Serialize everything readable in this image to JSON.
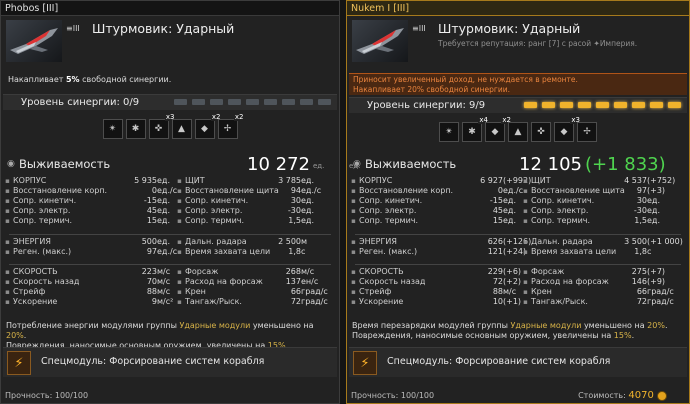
{
  "left": {
    "title": "Phobos [III]",
    "chevron": "≡III",
    "name": "Штурмовик: Ударный",
    "subtitle": "",
    "accum": [
      "Накапливает ",
      "5%",
      " свободной синергии."
    ],
    "syn_label": "Уровень синергии: 0/9",
    "syn_level": 0,
    "syn_max": 9,
    "mods": [
      {
        "g": "✴",
        "c": ""
      },
      {
        "g": "✱",
        "c": ""
      },
      {
        "g": "✜",
        "c": "x3"
      },
      {
        "g": "▲",
        "c": ""
      },
      {
        "g": "◆",
        "c": "x2"
      },
      {
        "g": "✢",
        "c": "x2"
      }
    ],
    "surv_label": "Выживаемость",
    "surv_value": "10 272",
    "surv_delta": "",
    "unit": "ед.",
    "rows1": [
      [
        "КОРПУС",
        "5 935",
        "ед.",
        "ЩИТ",
        "3 785",
        "ед."
      ],
      [
        "Восстановление корп.",
        "0",
        "ед./с",
        "Восстановление щита",
        "94",
        "ед./с"
      ],
      [
        "Сопр. кинетич.",
        "-15",
        "ед.",
        "Сопр. кинетич.",
        "30",
        "ед."
      ],
      [
        "Сопр. электр.",
        "45",
        "ед.",
        "Сопр. электр.",
        "-30",
        "ед."
      ],
      [
        "Сопр. термич.",
        "15",
        "ед.",
        "Сопр. термич.",
        "1,5",
        "ед."
      ]
    ],
    "rows2": [
      [
        "ЭНЕРГИЯ",
        "500",
        "ед.",
        "Дальн. радара",
        "2 500",
        "м"
      ],
      [
        "Реген. (макс.)",
        "97",
        "ед./с",
        "Время захвата цели",
        "1,8",
        "с"
      ]
    ],
    "rows3": [
      [
        "СКОРОСТЬ",
        "223",
        "м/с",
        "Форсаж",
        "268",
        "м/с"
      ],
      [
        "Скорость назад",
        "70",
        "м/с",
        "Расход на форсаж",
        "137",
        "ен/с"
      ],
      [
        "Стрейф",
        "88",
        "м/с",
        "Крен",
        "66",
        "град/с"
      ],
      [
        "Ускорение",
        "9",
        "м/с²",
        "Тангаж/Рыск.",
        "72",
        "град/с"
      ]
    ],
    "note": [
      "Потребление энергии модулями группы ",
      "Ударные модули",
      " уменьшено на ",
      "20%",
      ".",
      "Повреждения, наносимые основным оружием, увеличены на ",
      "15%",
      "."
    ],
    "spec": "Спецмодуль: Форсирование систем корабля",
    "durability": "Прочность: 100/100"
  },
  "right": {
    "title": "Nukem I [III]",
    "chevron": "≡III",
    "name": "Штурмовик: Ударный",
    "subtitle": "Требуется репутация: ранг [7] с расой ✦Империя.",
    "warn1": "Приносит увеличенный доход, не нуждается в ремонте.",
    "warn2": "Накапливает 20% свободной синергии.",
    "syn_label": "Уровень синергии: 9/9",
    "syn_level": 9,
    "syn_max": 9,
    "mods": [
      {
        "g": "✴",
        "c": ""
      },
      {
        "g": "✱",
        "c": "x4"
      },
      {
        "g": "◆",
        "c": "x2"
      },
      {
        "g": "▲",
        "c": ""
      },
      {
        "g": "✜",
        "c": ""
      },
      {
        "g": "◆",
        "c": "x3"
      },
      {
        "g": "✢",
        "c": ""
      }
    ],
    "surv_label": "Выживаемость",
    "surv_value": "12 105",
    "surv_delta": "(+1 833)",
    "unit": "ед.",
    "rows1": [
      [
        "КОРПУС",
        "6 927",
        "(+992)",
        "ЩИТ",
        "4 537",
        "(+752)"
      ],
      [
        "Восстановление корп.",
        "0",
        "ед./с",
        "Восстановление щита",
        "97",
        "(+3)"
      ],
      [
        "Сопр. кинетич.",
        "-15",
        "ед.",
        "Сопр. кинетич.",
        "30",
        "ед."
      ],
      [
        "Сопр. электр.",
        "45",
        "ед.",
        "Сопр. электр.",
        "-30",
        "ед."
      ],
      [
        "Сопр. термич.",
        "15",
        "ед.",
        "Сопр. термич.",
        "1,5",
        "ед."
      ]
    ],
    "rows2": [
      [
        "ЭНЕРГИЯ",
        "626",
        "(+126)",
        "Дальн. радара",
        "3 500",
        "(+1 000)"
      ],
      [
        "Реген. (макс.)",
        "121",
        "(+24)",
        "Время захвата цели",
        "1,8",
        "с"
      ]
    ],
    "rows3": [
      [
        "СКОРОСТЬ",
        "229",
        "(+6)",
        "Форсаж",
        "275",
        "(+7)"
      ],
      [
        "Скорость назад",
        "72",
        "(+2)",
        "Расход на форсаж",
        "146",
        "(+9)"
      ],
      [
        "Стрейф",
        "88",
        "м/с",
        "Крен",
        "66",
        "град/с"
      ],
      [
        "Ускорение",
        "10",
        "(+1)",
        "Тангаж/Рыск.",
        "72",
        "град/с"
      ]
    ],
    "note": [
      "Время перезарядки модулей группы ",
      "Ударные модули",
      " уменьшено на ",
      "20%",
      ".",
      "Повреждения, наносимые основным оружием, увеличены на ",
      "15%",
      "."
    ],
    "spec": "Спецмодуль: Форсирование систем корабля",
    "durability": "Прочность: 100/100",
    "cost_label": "Стоимость:",
    "cost_value": "4070"
  },
  "colors": {
    "gold": "#f0b32c",
    "green": "#5cd85c",
    "orange": "#e9843e"
  }
}
